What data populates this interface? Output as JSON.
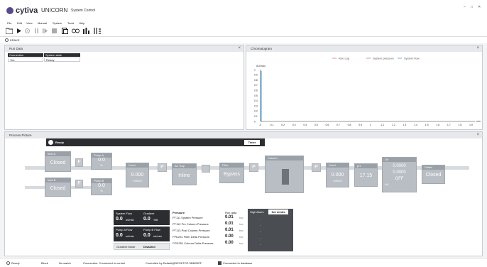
{
  "app": {
    "brand": "cytiva",
    "product": "UNICORN",
    "module": "System Control",
    "window_controls": [
      "–",
      "□",
      "✕"
    ]
  },
  "menu": [
    "File",
    "Edit",
    "View",
    "Manual",
    "System",
    "Tools",
    "Help"
  ],
  "system_name": "KRAKE",
  "run_data": {
    "title": "Run Data",
    "headers": [
      "Connection",
      "System state"
    ],
    "values": [
      "Yes",
      "Ready"
    ]
  },
  "chromatogram": {
    "title": "Chromatogram",
    "legend": [
      "Run Log",
      "System pressure",
      "System flow"
    ],
    "legend_colors": [
      "#e58fb5",
      "#c58fd6",
      "#5bb7e8"
    ],
    "ylabel": "AU/mAu",
    "xunit": "min"
  },
  "chart_data": {
    "type": "line",
    "title": "Chromatogram",
    "ylabel": "AU/mAu",
    "xlabel": "min",
    "xlim": [
      -0.01,
      1.9
    ],
    "ylim": [
      0,
      1
    ],
    "x_ticks": [
      "-0",
      "0.1",
      "0.2",
      "0.3",
      "0.4",
      "0.5",
      "0.6",
      "0.7",
      "0.8",
      "0.9",
      "1",
      "1.1",
      "1.2",
      "1.3",
      "1.4",
      "1.5",
      "1.6",
      "1.7",
      "1.8",
      "1.9"
    ],
    "y_ticks": [
      "1",
      "0.9",
      "0.8",
      "0.7",
      "0.6",
      "0.5",
      "0.4",
      "0.3",
      "0.2",
      "0.1",
      "0"
    ],
    "series": [
      {
        "name": "Run Log",
        "values": []
      },
      {
        "name": "System pressure",
        "values": []
      },
      {
        "name": "System flow",
        "values": []
      }
    ]
  },
  "process": {
    "title": "Process Picture",
    "status": "Ready",
    "timer_label": "Timer",
    "inlet_a": {
      "label": "Inlet A",
      "value": "Closed"
    },
    "inlet_b": {
      "label": "Inlet B",
      "value": "Closed"
    },
    "pump_a": {
      "label": "Pump A",
      "value": "0.0",
      "unit": "%"
    },
    "pump_b": {
      "label": "Pump B",
      "value": "0.0",
      "unit": "%"
    },
    "cond1": {
      "label": "Cond",
      "value": "0.000",
      "unit": "mS/cm"
    },
    "air_trap": {
      "label": "Air Trap",
      "value": "Inline"
    },
    "filter": {
      "label": "Filter",
      "value": "Bypass"
    },
    "column": {
      "label": "Column"
    },
    "cond2": {
      "label": "Cond",
      "value": "0.000",
      "unit": "mS/cm"
    },
    "ph": {
      "label": "pH",
      "value": "17.15"
    },
    "uv": {
      "label": "UV",
      "v1": "0.0000",
      "v2": "0.0000",
      "state": "OFF",
      "unit": "AU"
    },
    "outlet": {
      "label": "Outlet",
      "value": "Closed"
    },
    "mixer_label": "F",
    "pressure_label": "P"
  },
  "flows": {
    "system_flow_label": "System Flow",
    "system_flow_value": "0.0",
    "system_flow_unit": "ml/min",
    "gradient_label": "Gradient",
    "gradient_value": "0.0",
    "gradient_unit": "%B",
    "pump_a_flow_label": "Pump A Flow",
    "pump_a_flow_value": "0.0",
    "pump_b_flow_label": "Pump B Flow",
    "pump_b_flow_value": "0.0",
    "flow_unit": "ml/min",
    "gradient_mode_label": "Gradient Mode",
    "gradient_mode_value": "Disabled"
  },
  "pressure": {
    "title": "Pressure",
    "run_data_label": "Run data",
    "rows": [
      {
        "name": "PT111 System Pressure",
        "value": "0.01",
        "unit": "bar"
      },
      {
        "name": "PT112 Pre Column Pressure",
        "value": "0.01",
        "unit": "bar"
      },
      {
        "name": "PT113 Post Column Pressure",
        "value": "0.01",
        "unit": "bar"
      },
      {
        "name": "FPD231 Filter Delta Pressure",
        "value": "0.00",
        "unit": "bar"
      },
      {
        "name": "CPD251 Column Delta Pressure",
        "value": "0.00",
        "unit": "bar"
      }
    ]
  },
  "alarm": {
    "title": "High Alarm",
    "button": "Set Limits",
    "values": [
      "-",
      "-",
      "-",
      "-",
      "-"
    ]
  },
  "statusbar": {
    "ready": "Ready",
    "block": "Block",
    "no_watch": "No watch",
    "connection": "Connection: Connected in control",
    "controlled_by": "Controlled by Default@DESKTOP-0BM28FF",
    "database": "Connected to database"
  }
}
